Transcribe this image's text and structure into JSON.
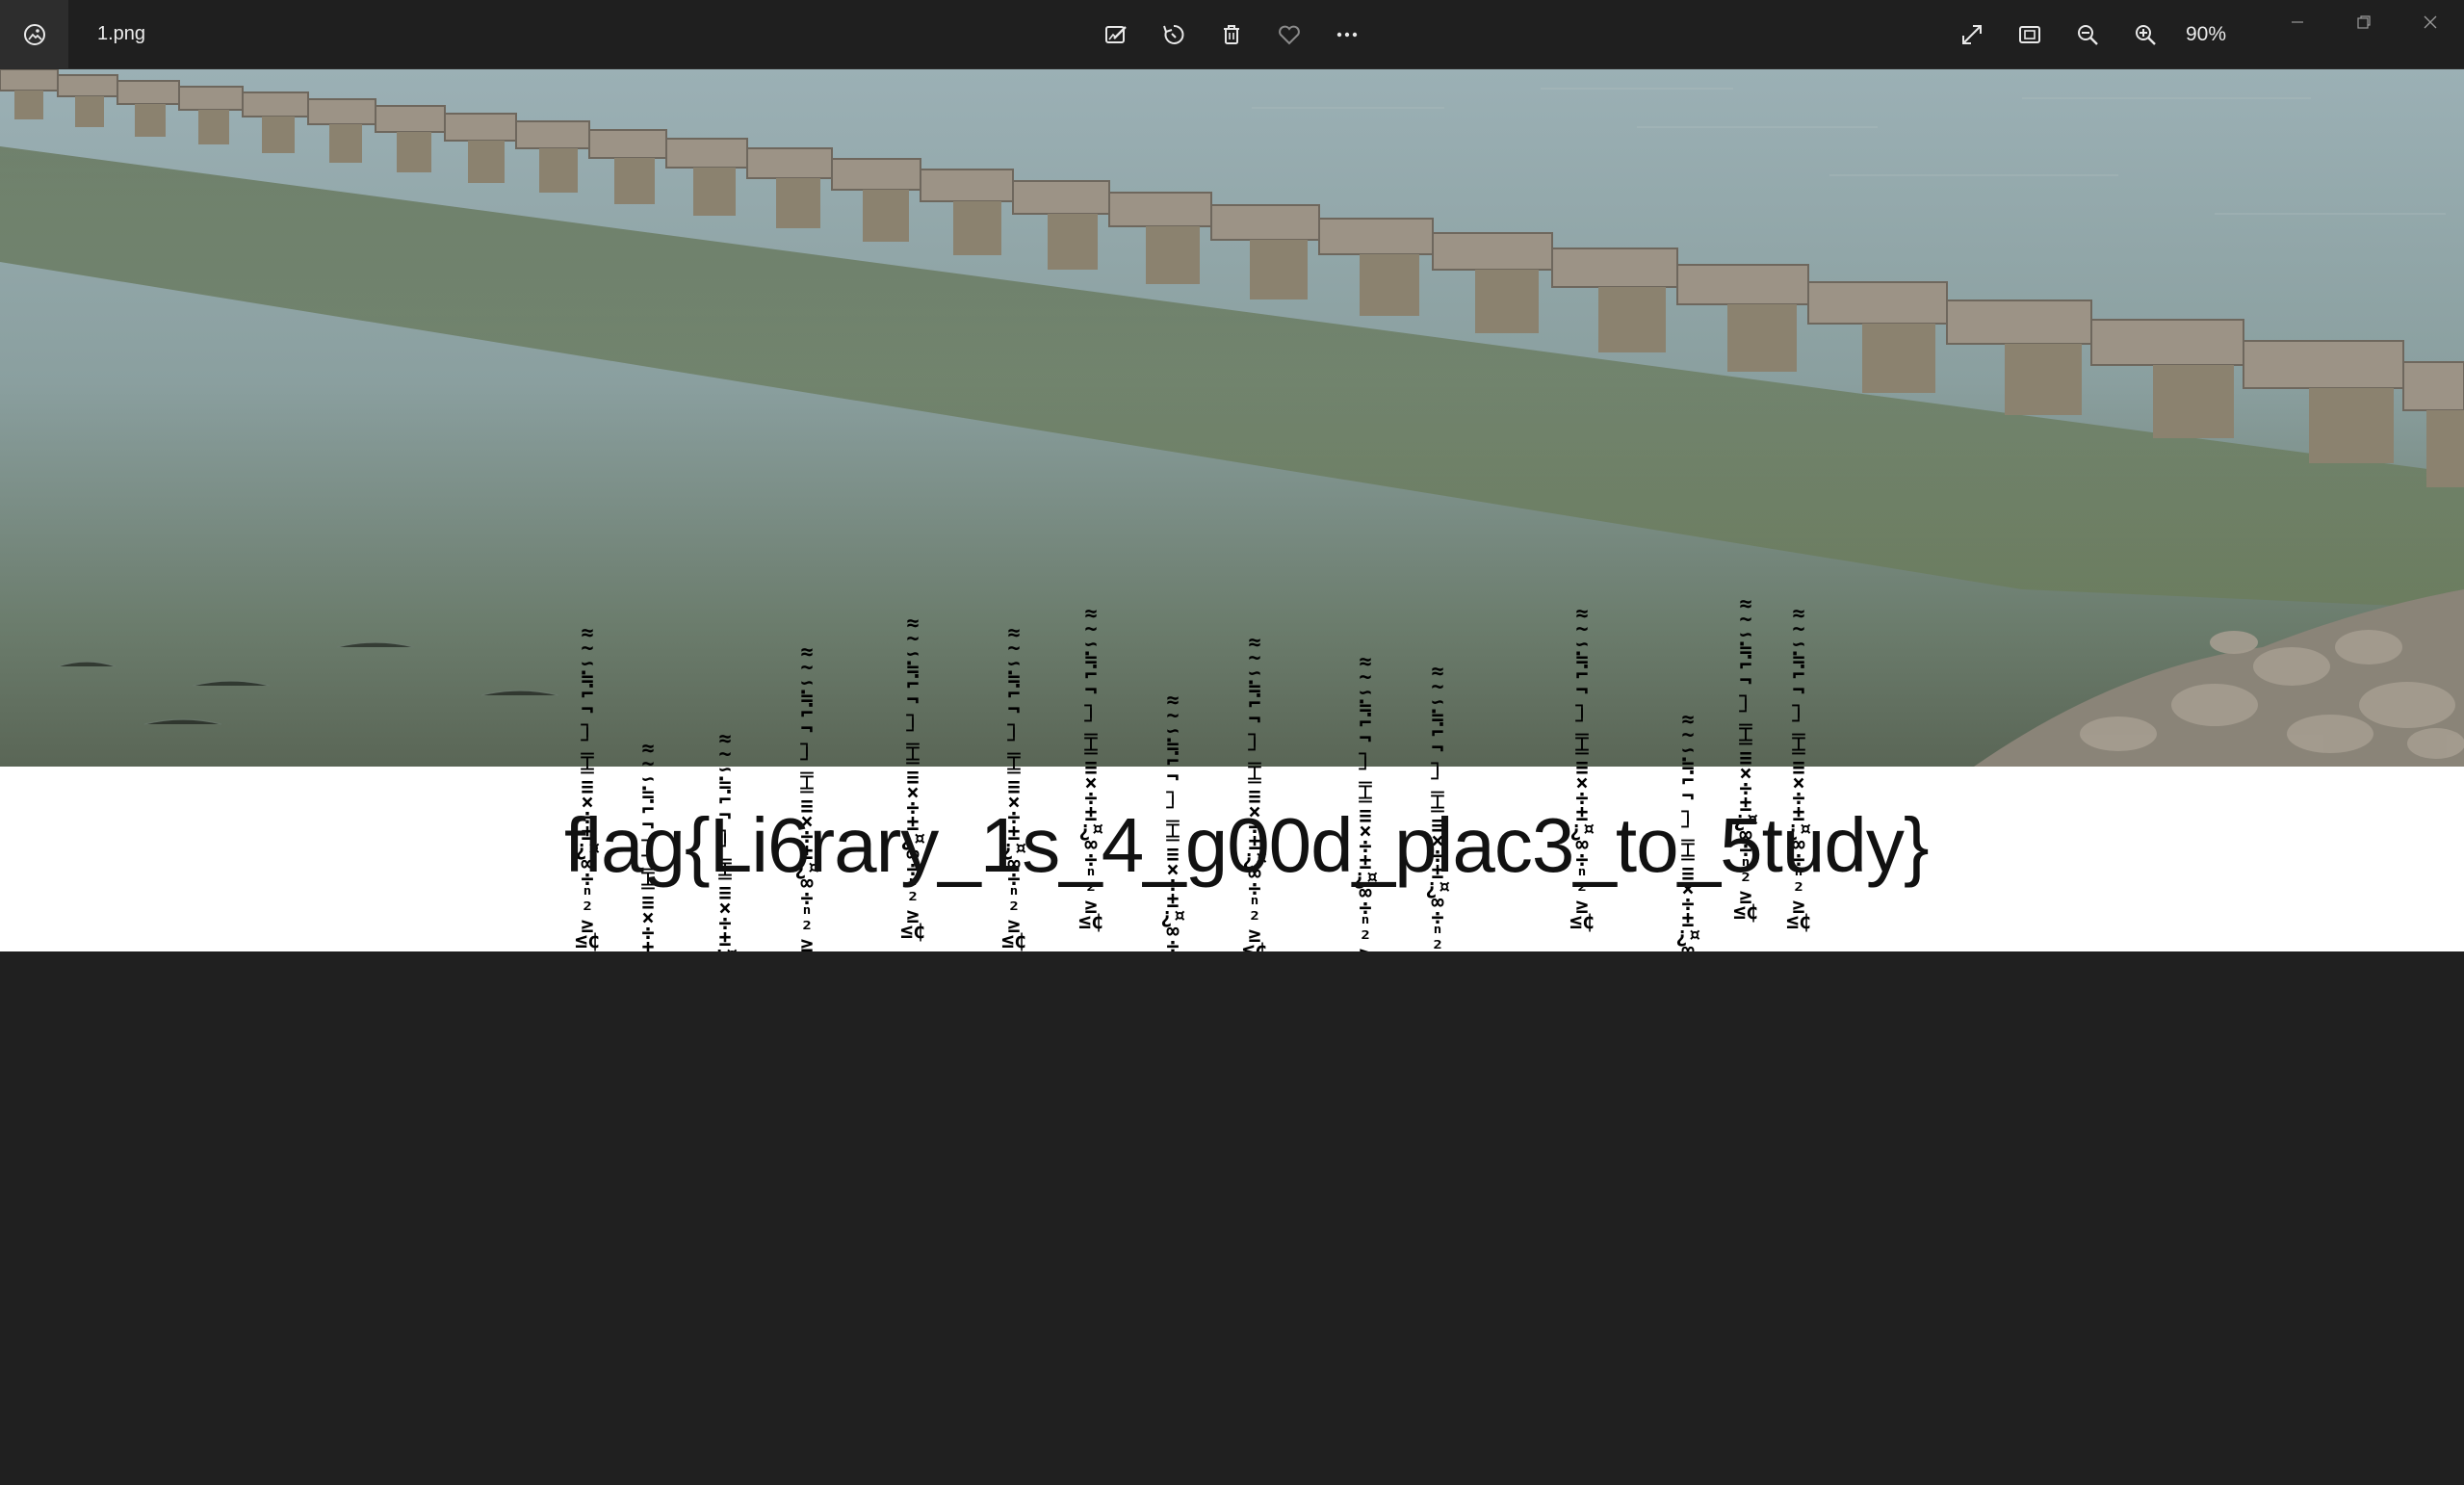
{
  "window": {
    "filename": "1.png",
    "zoom": "90%"
  },
  "toolbar": {
    "left_icons": [
      "edit-image-icon",
      "rotate-icon",
      "delete-icon",
      "favorite-icon",
      "more-icon"
    ],
    "right_icons": [
      "fullscreen-icon",
      "fit-window-icon",
      "zoom-out-icon",
      "zoom-in-icon"
    ]
  },
  "window_controls": [
    "minimize-icon",
    "restore-icon",
    "close-icon"
  ],
  "image": {
    "overlay_text": "flag{Li6rary_1s_4_g00d_plac3_to_5tudy}",
    "noise_glyphs": "≈~∽≒⌐¬┐┘╤╧≡×÷±¿¤§°∞÷ⁿ²≥≤¢"
  }
}
